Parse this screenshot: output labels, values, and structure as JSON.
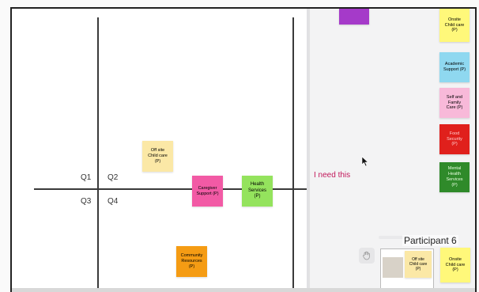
{
  "quadrants": {
    "q1": "Q1",
    "q2": "Q2",
    "q3": "Q3",
    "q4": "Q4"
  },
  "stickies": {
    "offsite_childcare_left": "Off site\nChild care\n(P)",
    "caregiver_support": "Caregiver\nSupport (P)",
    "health_services": "Health\nServices\n(P)",
    "community_resources": "Community\nResources (P)",
    "onsite_childcare": "Onsite\nChild care\n(P)",
    "academic_support": "Academic\nSupport (P)",
    "self_family_care": "Self and\nFamily\nCare (P)",
    "food_security": "Food\nSecurity\n(P)",
    "mental_health": "Mental\nHealth\nServices\n(P)"
  },
  "annotation": "I need this",
  "participant": "Participant 6",
  "thumbnail": {
    "offsite": "Off site\nChild care\n(P)",
    "onsite": "Onsite\nChild care\n(P)"
  },
  "colors": {
    "yellow": "#fbe8a6",
    "bright_yellow": "#fff87a",
    "pink": "#f25aa5",
    "green": "#94e35d",
    "orange": "#f59c14",
    "blue": "#8fd8f0",
    "light_pink": "#f8b9d9",
    "red": "#e0201c",
    "dark_green": "#2f8a2a",
    "purple": "#a53ac9",
    "annotation": "#c2185b"
  },
  "icons": {
    "cursor": "arrow-cursor-icon",
    "hand": "hand-icon"
  }
}
